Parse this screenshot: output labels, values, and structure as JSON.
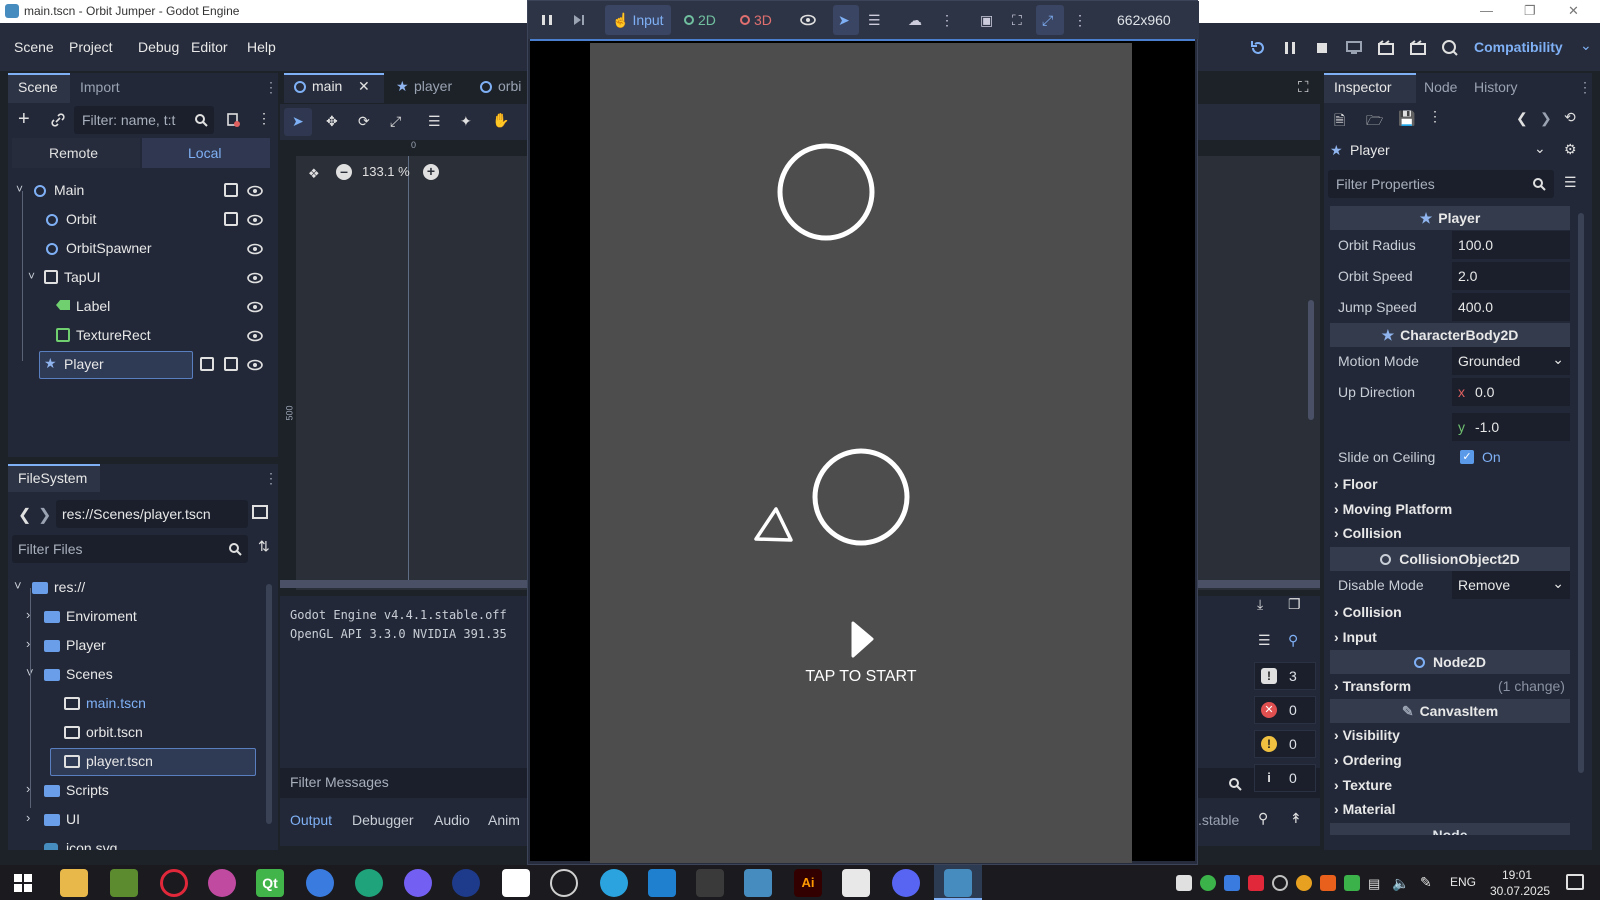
{
  "window": {
    "title": "main.tscn - Orbit Jumper - Godot Engine"
  },
  "menubar": {
    "items": [
      "Scene",
      "Project",
      "Debug",
      "Editor",
      "Help"
    ],
    "renderer": "Compatibility"
  },
  "scene_dock": {
    "tabs": [
      "Scene",
      "Import"
    ],
    "filter_placeholder": "Filter: name, t:t",
    "remote_label": "Remote",
    "local_label": "Local",
    "nodes": [
      {
        "label": "Main",
        "depth": 0,
        "icon": "node2d-icon"
      },
      {
        "label": "Orbit",
        "depth": 1,
        "icon": "node2d-icon"
      },
      {
        "label": "OrbitSpawner",
        "depth": 1,
        "icon": "node2d-icon"
      },
      {
        "label": "TapUI",
        "depth": 0,
        "icon": "control-icon"
      },
      {
        "label": "Label",
        "depth": 1,
        "icon": "label-icon"
      },
      {
        "label": "TextureRect",
        "depth": 1,
        "icon": "texture-icon"
      },
      {
        "label": "Player",
        "depth": 0,
        "icon": "character-icon",
        "selected": true
      }
    ]
  },
  "filesystem": {
    "tab": "FileSystem",
    "path": "res://Scenes/player.tscn",
    "filter_placeholder": "Filter Files",
    "items": [
      {
        "label": "res://",
        "depth": 0,
        "type": "folder"
      },
      {
        "label": "Enviroment",
        "depth": 1,
        "type": "folder"
      },
      {
        "label": "Player",
        "depth": 1,
        "type": "folder"
      },
      {
        "label": "Scenes",
        "depth": 1,
        "type": "folder"
      },
      {
        "label": "main.tscn",
        "depth": 2,
        "type": "scene",
        "highlight": true
      },
      {
        "label": "orbit.tscn",
        "depth": 2,
        "type": "scene"
      },
      {
        "label": "player.tscn",
        "depth": 2,
        "type": "scene",
        "selected": true
      },
      {
        "label": "Scripts",
        "depth": 1,
        "type": "folder"
      },
      {
        "label": "UI",
        "depth": 1,
        "type": "folder"
      },
      {
        "label": "icon.svg",
        "depth": 1,
        "type": "file"
      }
    ]
  },
  "editor": {
    "tabs": [
      "main",
      "player",
      "orbi"
    ],
    "zoom": "133.1 %",
    "ruler_mark": "0",
    "ruler_side": "500"
  },
  "output": {
    "lines": [
      "Godot Engine v4.4.1.stable.off",
      "OpenGL API 3.3.0 NVIDIA 391.35"
    ],
    "filter_placeholder": "Filter Messages",
    "bottom_tabs": [
      "Output",
      "Debugger",
      "Audio",
      "Anim"
    ],
    "stable_fragment": ".stable",
    "counts": {
      "messages": "3",
      "errors": "0",
      "warnings": "0",
      "info": "0"
    }
  },
  "game_window": {
    "toolbar": {
      "input": "Input",
      "two_d": "2D",
      "three_d": "3D",
      "size": "662x960"
    },
    "tap_text": "TAP TO START"
  },
  "inspector": {
    "tabs": [
      "Inspector",
      "Node",
      "History"
    ],
    "node_name": "Player",
    "filter_placeholder": "Filter Properties",
    "player_section": "Player",
    "orbit_radius_label": "Orbit Radius",
    "orbit_radius": "100.0",
    "orbit_speed_label": "Orbit Speed",
    "orbit_speed": "2.0",
    "jump_speed_label": "Jump Speed",
    "jump_speed": "400.0",
    "cb2d_section": "CharacterBody2D",
    "motion_mode_label": "Motion Mode",
    "motion_mode": "Grounded",
    "up_direction_label": "Up Direction",
    "up_x_label": "x",
    "up_x": "0.0",
    "up_y_label": "y",
    "up_y": "-1.0",
    "slide_label": "Slide on Ceiling",
    "slide_value": "On",
    "groups1": [
      "Floor",
      "Moving Platform",
      "Collision"
    ],
    "co2d_section": "CollisionObject2D",
    "disable_mode_label": "Disable Mode",
    "disable_mode": "Remove",
    "groups2": [
      "Collision",
      "Input"
    ],
    "node2d_section": "Node2D",
    "transform_label": "Transform",
    "transform_change": "(1 change)",
    "canvas_section": "CanvasItem",
    "groups3": [
      "Visibility",
      "Ordering",
      "Texture",
      "Material"
    ],
    "node_section": "Node"
  },
  "taskbar": {
    "lang": "ENG",
    "time": "19:01",
    "date": "30.07.2025"
  }
}
